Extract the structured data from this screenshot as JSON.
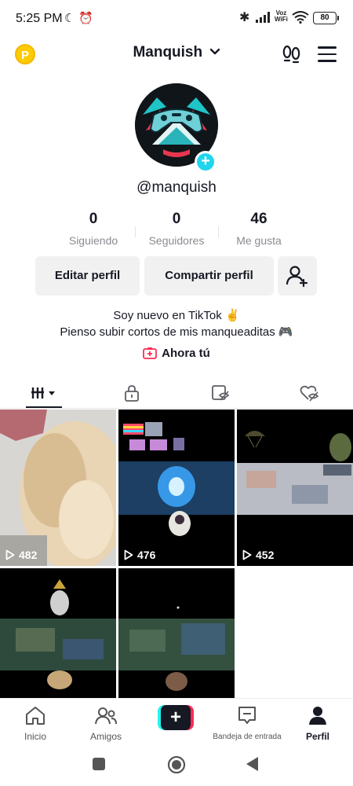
{
  "status_bar": {
    "time": "5:25 PM",
    "vo": "Voz",
    "wifi_label": "WiFi",
    "battery": "80"
  },
  "header": {
    "account_name": "Manquish",
    "coin_letter": "P"
  },
  "profile": {
    "username": "@manquish",
    "stats": [
      {
        "value": "0",
        "label": "Siguiendo"
      },
      {
        "value": "0",
        "label": "Seguidores"
      },
      {
        "value": "46",
        "label": "Me gusta"
      }
    ],
    "buttons": {
      "edit": "Editar perfil",
      "share": "Compartir perfil"
    },
    "bio_line1": "Soy nuevo en TikTok ✌️",
    "bio_line2": "Pienso subir cortos de mis manqueaditas 🎮",
    "ahora_tu": "Ahora tú"
  },
  "videos": [
    {
      "views": "482"
    },
    {
      "views": "476"
    },
    {
      "views": "452"
    },
    {
      "views": ""
    },
    {
      "views": ""
    }
  ],
  "bottom_nav": {
    "items": [
      "Inicio",
      "Amigos",
      "",
      "Bandeja de entrada",
      "Perfil"
    ],
    "active": "Perfil"
  },
  "colors": {
    "accent_cyan": "#20d5ec",
    "accent_red": "#fe2c55",
    "coin": "#fecb00"
  }
}
